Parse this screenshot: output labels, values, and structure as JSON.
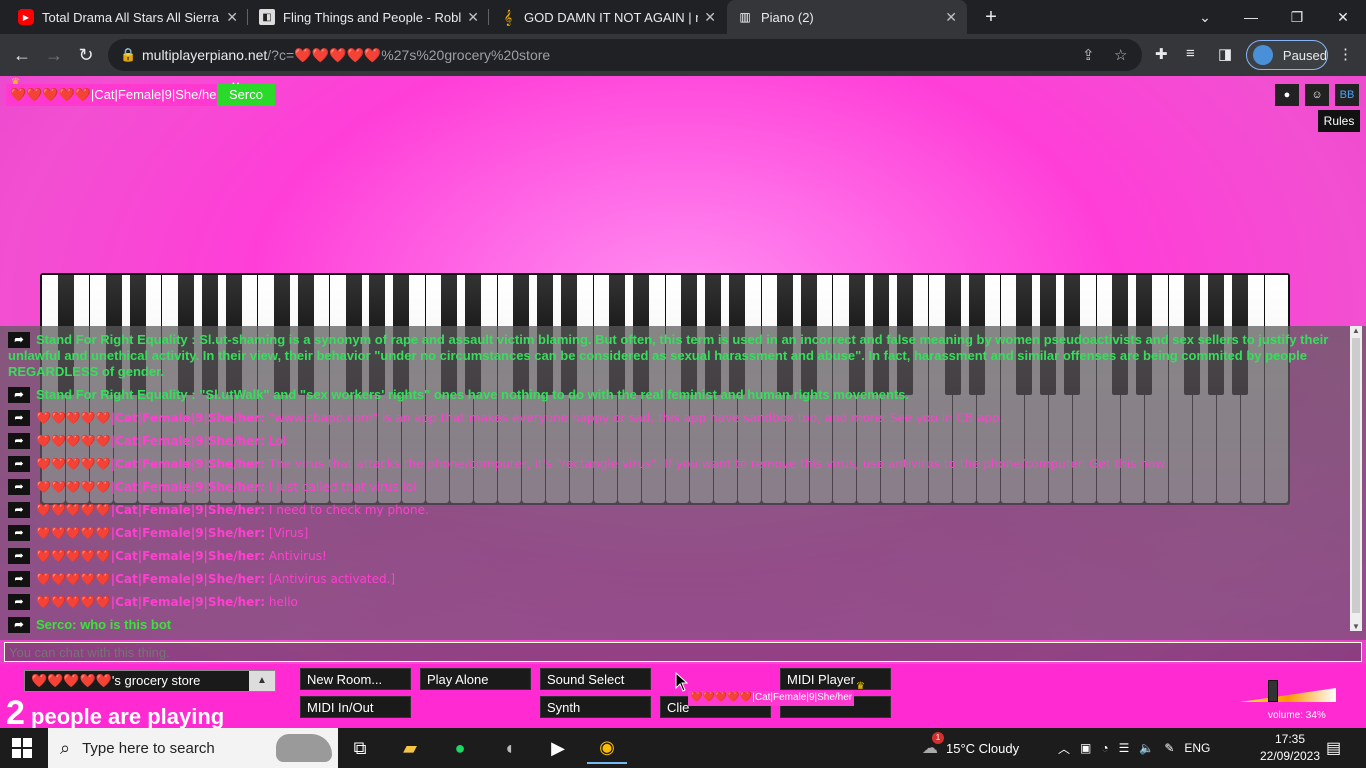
{
  "browser": {
    "tabs": [
      {
        "title": "Total Drama All Stars All Sierra Sc",
        "icon": "youtube-icon"
      },
      {
        "title": "Fling Things and People - Roblox",
        "icon": "roblox-icon"
      },
      {
        "title": "GOD DAMN IT NOT AGAIN | mpp",
        "icon": "music-note-icon"
      },
      {
        "title": "Piano (2)",
        "icon": "piano-icon"
      }
    ],
    "new_tab": "+",
    "url_host": "multiplayerpiano.net",
    "url_rest": "/?c=❤️❤️❤️❤️❤️%27s%20grocery%20store",
    "profile_label": "Paused"
  },
  "page": {
    "user_tag": "❤️❤️❤️❤️❤️|Cat|Female|9|She/her",
    "me_label": "Me",
    "me_name": "Serco",
    "rules": "Rules",
    "corner_buttons": [
      "reddit-icon",
      "discord-icon",
      "bb-icon"
    ],
    "bb_label": "BB"
  },
  "chat": {
    "messages": [
      {
        "who": "Stand For Right Equality :",
        "text": "Sl.ut-shaming is a synonym of rape and assault victim blaming. But often, this term is used in an incorrect and false meaning by women pseudoactivists and sex sellers to justify their unlawful and unethical activity. In their view, their behavior \"under no circumstances can be considered as sexual harassment and abuse\". In fact, harassment and similar offenses are being commited by people REGARDLESS of gender."
      },
      {
        "who": "Stand For Right Equality :",
        "text": "\"Sl.utWalk\" and \"sex workers' rights\" ones have nothing to do with the real feminist and human rights movements."
      },
      {
        "who": "❤️❤️❤️❤️❤️|Cat|Female|9|She/her:",
        "text": "\"www.cbapp.com\" is an app that makes everyone happy or sad, this app have sandbox too, and more. See you in CB app."
      },
      {
        "who": "❤️❤️❤️❤️❤️|Cat|Female|9|She/her:",
        "text": "Lol"
      },
      {
        "who": "❤️❤️❤️❤️❤️|Cat|Female|9|She/her:",
        "text": "The virus that attacks the phone/computer, it's \"rectangle virus\". If you want to remove this virus, use antivirus to the phone/computer. Get this now."
      },
      {
        "who": "❤️❤️❤️❤️❤️|Cat|Female|9|She/her:",
        "text": "I just called that virus lol"
      },
      {
        "who": "❤️❤️❤️❤️❤️|Cat|Female|9|She/her:",
        "text": "I need to check my phone."
      },
      {
        "who": "❤️❤️❤️❤️❤️|Cat|Female|9|She/her:",
        "text": "[Virus]"
      },
      {
        "who": "❤️❤️❤️❤️❤️|Cat|Female|9|She/her:",
        "text": "Antivirus!"
      },
      {
        "who": "❤️❤️❤️❤️❤️|Cat|Female|9|She/her:",
        "text": "[Antivirus activated.]"
      },
      {
        "who": "❤️❤️❤️❤️❤️|Cat|Female|9|She/her:",
        "text": "hello"
      },
      {
        "who": "Serco:",
        "text": "who is this bot"
      }
    ],
    "input_placeholder": "You can chat with this thing."
  },
  "bottom": {
    "room_name": "❤️❤️❤️❤️❤️'s grocery store",
    "people_count": "2",
    "people_text": "people are playing",
    "buttons": {
      "new_room": "New Room...",
      "play_alone": "Play Alone",
      "sound_select": "Sound Select",
      "midi_player": "MIDI Player",
      "midi_inout": "MIDI In/Out",
      "synth": "Synth",
      "client": "Clie"
    },
    "drag_tag": "❤️❤️❤️❤️❤️|Cat|Female|9|She/her",
    "volume_label": "volume: 34%",
    "volume_level": 0.34
  },
  "taskbar": {
    "search_placeholder": "Type here to search",
    "weather": "15°C  Cloudy",
    "weather_badge": "1",
    "lang": "ENG",
    "time": "17:35",
    "date": "22/09/2023"
  }
}
